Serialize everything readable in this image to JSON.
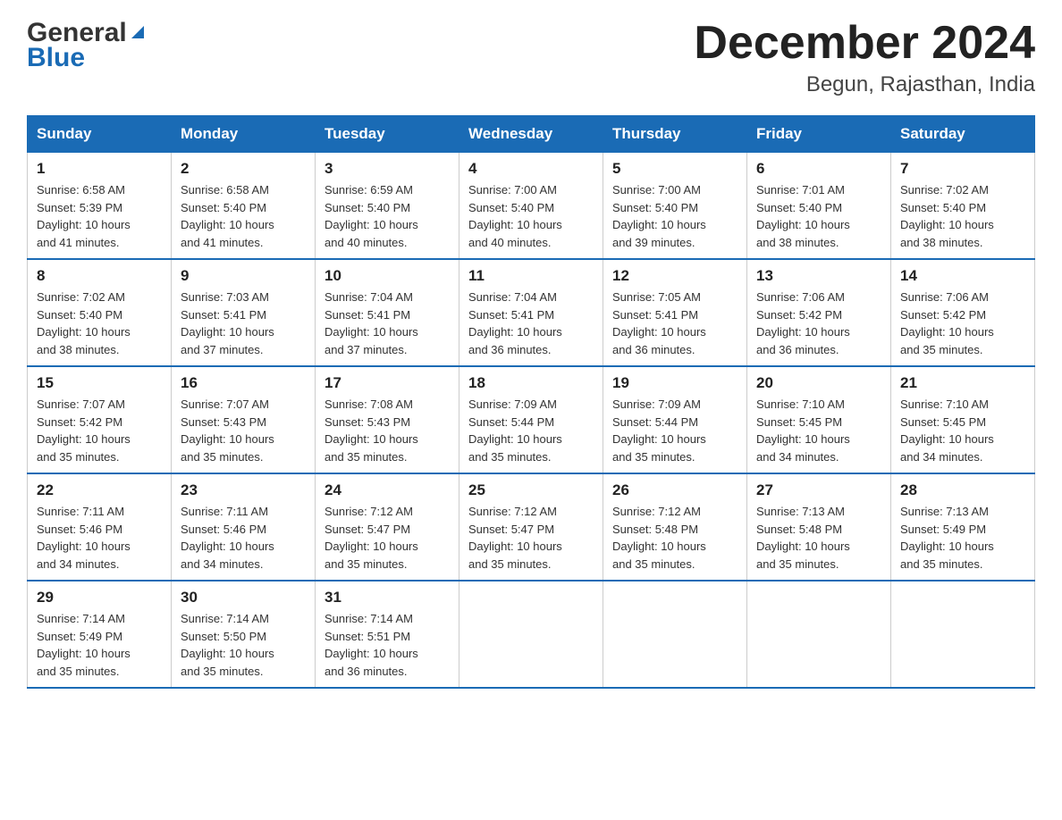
{
  "logo": {
    "general": "General",
    "blue": "Blue"
  },
  "title": "December 2024",
  "subtitle": "Begun, Rajasthan, India",
  "weekdays": [
    "Sunday",
    "Monday",
    "Tuesday",
    "Wednesday",
    "Thursday",
    "Friday",
    "Saturday"
  ],
  "weeks": [
    [
      {
        "day": "1",
        "sunrise": "6:58 AM",
        "sunset": "5:39 PM",
        "daylight": "10 hours and 41 minutes."
      },
      {
        "day": "2",
        "sunrise": "6:58 AM",
        "sunset": "5:40 PM",
        "daylight": "10 hours and 41 minutes."
      },
      {
        "day": "3",
        "sunrise": "6:59 AM",
        "sunset": "5:40 PM",
        "daylight": "10 hours and 40 minutes."
      },
      {
        "day": "4",
        "sunrise": "7:00 AM",
        "sunset": "5:40 PM",
        "daylight": "10 hours and 40 minutes."
      },
      {
        "day": "5",
        "sunrise": "7:00 AM",
        "sunset": "5:40 PM",
        "daylight": "10 hours and 39 minutes."
      },
      {
        "day": "6",
        "sunrise": "7:01 AM",
        "sunset": "5:40 PM",
        "daylight": "10 hours and 38 minutes."
      },
      {
        "day": "7",
        "sunrise": "7:02 AM",
        "sunset": "5:40 PM",
        "daylight": "10 hours and 38 minutes."
      }
    ],
    [
      {
        "day": "8",
        "sunrise": "7:02 AM",
        "sunset": "5:40 PM",
        "daylight": "10 hours and 38 minutes."
      },
      {
        "day": "9",
        "sunrise": "7:03 AM",
        "sunset": "5:41 PM",
        "daylight": "10 hours and 37 minutes."
      },
      {
        "day": "10",
        "sunrise": "7:04 AM",
        "sunset": "5:41 PM",
        "daylight": "10 hours and 37 minutes."
      },
      {
        "day": "11",
        "sunrise": "7:04 AM",
        "sunset": "5:41 PM",
        "daylight": "10 hours and 36 minutes."
      },
      {
        "day": "12",
        "sunrise": "7:05 AM",
        "sunset": "5:41 PM",
        "daylight": "10 hours and 36 minutes."
      },
      {
        "day": "13",
        "sunrise": "7:06 AM",
        "sunset": "5:42 PM",
        "daylight": "10 hours and 36 minutes."
      },
      {
        "day": "14",
        "sunrise": "7:06 AM",
        "sunset": "5:42 PM",
        "daylight": "10 hours and 35 minutes."
      }
    ],
    [
      {
        "day": "15",
        "sunrise": "7:07 AM",
        "sunset": "5:42 PM",
        "daylight": "10 hours and 35 minutes."
      },
      {
        "day": "16",
        "sunrise": "7:07 AM",
        "sunset": "5:43 PM",
        "daylight": "10 hours and 35 minutes."
      },
      {
        "day": "17",
        "sunrise": "7:08 AM",
        "sunset": "5:43 PM",
        "daylight": "10 hours and 35 minutes."
      },
      {
        "day": "18",
        "sunrise": "7:09 AM",
        "sunset": "5:44 PM",
        "daylight": "10 hours and 35 minutes."
      },
      {
        "day": "19",
        "sunrise": "7:09 AM",
        "sunset": "5:44 PM",
        "daylight": "10 hours and 35 minutes."
      },
      {
        "day": "20",
        "sunrise": "7:10 AM",
        "sunset": "5:45 PM",
        "daylight": "10 hours and 34 minutes."
      },
      {
        "day": "21",
        "sunrise": "7:10 AM",
        "sunset": "5:45 PM",
        "daylight": "10 hours and 34 minutes."
      }
    ],
    [
      {
        "day": "22",
        "sunrise": "7:11 AM",
        "sunset": "5:46 PM",
        "daylight": "10 hours and 34 minutes."
      },
      {
        "day": "23",
        "sunrise": "7:11 AM",
        "sunset": "5:46 PM",
        "daylight": "10 hours and 34 minutes."
      },
      {
        "day": "24",
        "sunrise": "7:12 AM",
        "sunset": "5:47 PM",
        "daylight": "10 hours and 35 minutes."
      },
      {
        "day": "25",
        "sunrise": "7:12 AM",
        "sunset": "5:47 PM",
        "daylight": "10 hours and 35 minutes."
      },
      {
        "day": "26",
        "sunrise": "7:12 AM",
        "sunset": "5:48 PM",
        "daylight": "10 hours and 35 minutes."
      },
      {
        "day": "27",
        "sunrise": "7:13 AM",
        "sunset": "5:48 PM",
        "daylight": "10 hours and 35 minutes."
      },
      {
        "day": "28",
        "sunrise": "7:13 AM",
        "sunset": "5:49 PM",
        "daylight": "10 hours and 35 minutes."
      }
    ],
    [
      {
        "day": "29",
        "sunrise": "7:14 AM",
        "sunset": "5:49 PM",
        "daylight": "10 hours and 35 minutes."
      },
      {
        "day": "30",
        "sunrise": "7:14 AM",
        "sunset": "5:50 PM",
        "daylight": "10 hours and 35 minutes."
      },
      {
        "day": "31",
        "sunrise": "7:14 AM",
        "sunset": "5:51 PM",
        "daylight": "10 hours and 36 minutes."
      },
      null,
      null,
      null,
      null
    ]
  ],
  "labels": {
    "sunrise": "Sunrise:",
    "sunset": "Sunset:",
    "daylight": "Daylight:"
  }
}
